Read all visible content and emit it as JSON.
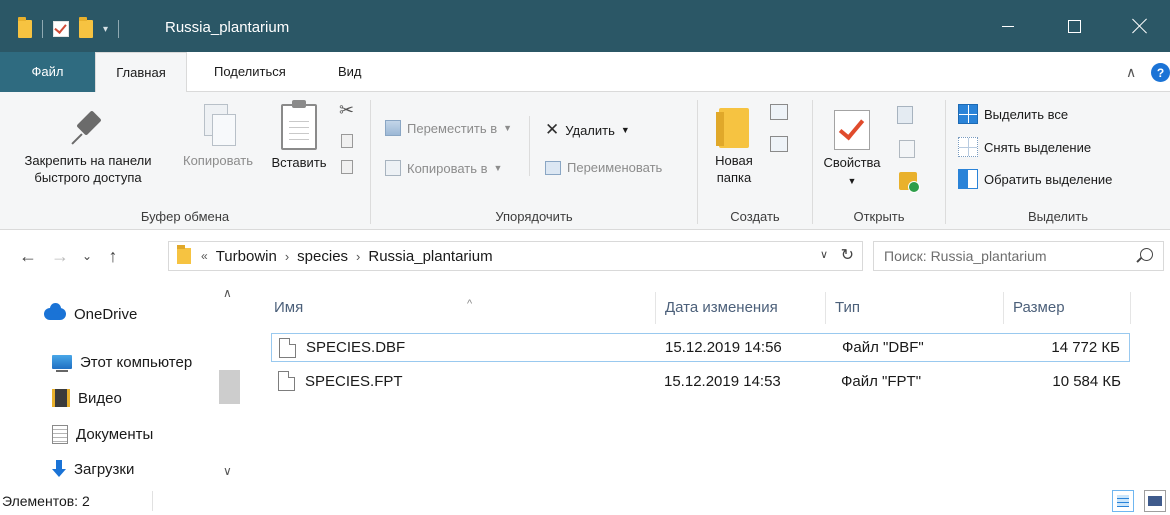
{
  "window": {
    "title": "Russia_plantarium",
    "qat_dropdown_glyph": "▾",
    "minimize_label": "Свернуть",
    "maximize_label": "Развернуть",
    "close_label": "Закрыть"
  },
  "ribbon_tabs": {
    "file": "Файл",
    "home": "Главная",
    "share": "Поделиться",
    "view": "Вид",
    "help_glyph": "?"
  },
  "ribbon": {
    "clipboard": {
      "pin_label_1": "Закрепить на панели",
      "pin_label_2": "быстрого доступа",
      "copy_label": "Копировать",
      "paste_label": "Вставить",
      "group_label": "Буфер обмена"
    },
    "organize": {
      "move_to": "Переместить в",
      "copy_to": "Копировать в",
      "delete": "Удалить",
      "rename": "Переименовать",
      "group_label": "Упорядочить"
    },
    "new": {
      "new_folder_1": "Новая",
      "new_folder_2": "папка",
      "group_label": "Создать"
    },
    "open": {
      "properties": "Свойства",
      "group_label": "Открыть"
    },
    "select": {
      "select_all": "Выделить все",
      "select_none": "Снять выделение",
      "invert": "Обратить выделение",
      "group_label": "Выделить"
    }
  },
  "address": {
    "history_glyph": "«",
    "crumbs": [
      "Turbowin",
      "species",
      "Russia_plantarium"
    ],
    "search_placeholder": "Поиск: Russia_plantarium"
  },
  "nav_pane": {
    "items": [
      "OneDrive",
      "Этот компьютер",
      "Видео",
      "Документы",
      "Загрузки"
    ]
  },
  "file_list": {
    "columns": [
      "Имя",
      "Дата изменения",
      "Тип",
      "Размер"
    ],
    "rows": [
      {
        "name": "SPECIES.DBF",
        "date": "15.12.2019 14:56",
        "type": "Файл \"DBF\"",
        "size": "14 772 КБ"
      },
      {
        "name": "SPECIES.FPT",
        "date": "15.12.2019 14:53",
        "type": "Файл \"FPT\"",
        "size": "10 584 КБ"
      }
    ]
  },
  "status": {
    "items_count": "Элементов: 2"
  },
  "colors": {
    "titlebar": "#2b5766",
    "file_tab": "#2f6b80",
    "selection_border": "#99c9ef"
  }
}
